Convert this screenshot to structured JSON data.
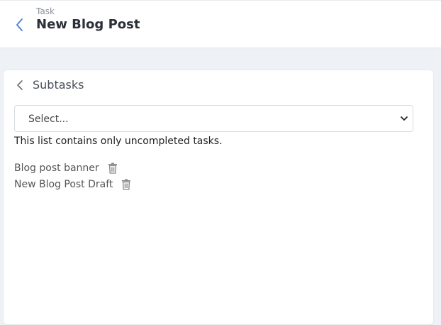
{
  "header": {
    "eyebrow": "Task",
    "title": "New Blog Post",
    "back_icon": "chevron-left-icon"
  },
  "subtasks": {
    "title": "Subtasks",
    "back_icon": "chevron-left-icon",
    "select": {
      "value": "Select..."
    },
    "hint": "This list contains only uncompleted tasks.",
    "items": [
      {
        "label": "Blog post banner",
        "icon": "trash-icon"
      },
      {
        "label": "New Blog Post Draft",
        "icon": "trash-icon"
      }
    ]
  },
  "colors": {
    "accent": "#4a7fd4",
    "background": "#eef1f5"
  }
}
